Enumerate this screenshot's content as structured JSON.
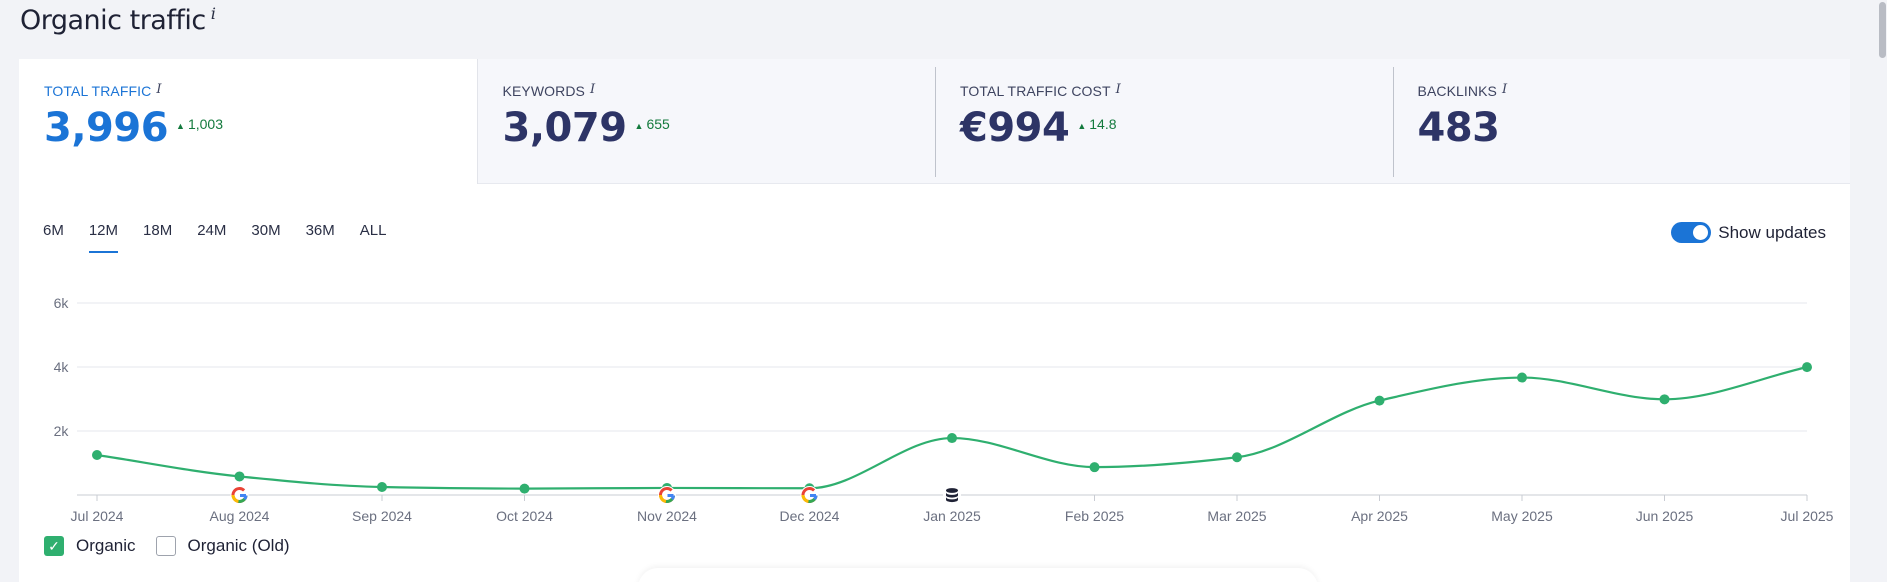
{
  "page": {
    "title": "Organic traffic",
    "info": "i"
  },
  "metrics": [
    {
      "label": "TOTAL TRAFFIC",
      "info": "i",
      "value": "3,996",
      "delta": "1,003"
    },
    {
      "label": "KEYWORDS",
      "info": "i",
      "value": "3,079",
      "delta": "655"
    },
    {
      "label": "TOTAL TRAFFIC COST",
      "info": "i",
      "value": "€994",
      "delta": "14.8"
    },
    {
      "label": "BACKLINKS",
      "info": "i",
      "value": "483"
    }
  ],
  "ranges": [
    "6M",
    "12M",
    "18M",
    "24M",
    "30M",
    "36M",
    "ALL"
  ],
  "active_range": "12M",
  "toggle": {
    "label": "Show updates",
    "on": true
  },
  "legend": [
    {
      "label": "Organic",
      "checked": true
    },
    {
      "label": "Organic (Old)",
      "checked": false
    }
  ],
  "colors": {
    "accent": "#1b74d6",
    "series": "#2faf6f",
    "delta": "#137a3d"
  },
  "icons": {
    "google_update": "google-g-icon",
    "database_update": "database-icon",
    "delta": "triangle-up-icon",
    "checkbox": "checkmark-icon"
  },
  "chart_data": {
    "type": "line",
    "categories": [
      "Jul 2024",
      "Aug 2024",
      "Sep 2024",
      "Oct 2024",
      "Nov 2024",
      "Dec 2024",
      "Jan 2025",
      "Feb 2025",
      "Mar 2025",
      "Apr 2025",
      "May 2025",
      "Jun 2025",
      "Jul 2025"
    ],
    "series": [
      {
        "name": "Organic",
        "values": [
          1250,
          580,
          250,
          200,
          220,
          210,
          1780,
          870,
          1180,
          2950,
          3670,
          2990,
          3996
        ]
      }
    ],
    "ylim": [
      0,
      6000
    ],
    "yticks": [
      2000,
      4000,
      6000
    ],
    "ytick_labels": [
      "2k",
      "4k",
      "6k"
    ],
    "grid": true,
    "update_markers": [
      {
        "category": "Aug 2024",
        "icon": "google-g-icon"
      },
      {
        "category": "Nov 2024",
        "icon": "google-g-icon"
      },
      {
        "category": "Dec 2024",
        "icon": "google-g-icon"
      },
      {
        "category": "Jan 2025",
        "icon": "database-icon"
      }
    ]
  }
}
